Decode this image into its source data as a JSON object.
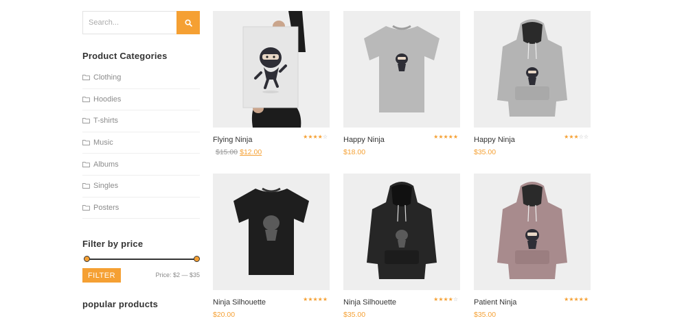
{
  "search": {
    "placeholder": "Search..."
  },
  "categories": {
    "title": "Product Categories",
    "items": [
      {
        "label": "Clothing"
      },
      {
        "label": "Hoodies"
      },
      {
        "label": "T-shirts"
      },
      {
        "label": "Music"
      },
      {
        "label": "Albums"
      },
      {
        "label": "Singles"
      },
      {
        "label": "Posters"
      }
    ]
  },
  "price_filter": {
    "title": "Filter by price",
    "button_label": "FILTER",
    "range_text": "Price: $2 — $35"
  },
  "popular": {
    "title": "popular products"
  },
  "colors": {
    "accent": "#f5a033",
    "image_bg": "#eeeeee"
  },
  "products": [
    {
      "name": "Flying Ninja",
      "old_price": "$15.00",
      "price": "$12.00",
      "rating": 4,
      "image": "poster-icon"
    },
    {
      "name": "Happy Ninja",
      "price": "$18.00",
      "rating": 5,
      "image": "grey-tshirt-icon"
    },
    {
      "name": "Happy Ninja",
      "price": "$35.00",
      "rating": 3,
      "image": "grey-hoodie-icon"
    },
    {
      "name": "Ninja Silhouette",
      "price": "$20.00",
      "rating": 5,
      "image": "black-tshirt-icon"
    },
    {
      "name": "Ninja Silhouette",
      "price": "$35.00",
      "rating": 4,
      "image": "black-hoodie-icon"
    },
    {
      "name": "Patient Ninja",
      "price": "$35.00",
      "rating": 5,
      "image": "mauve-hoodie-icon"
    }
  ]
}
